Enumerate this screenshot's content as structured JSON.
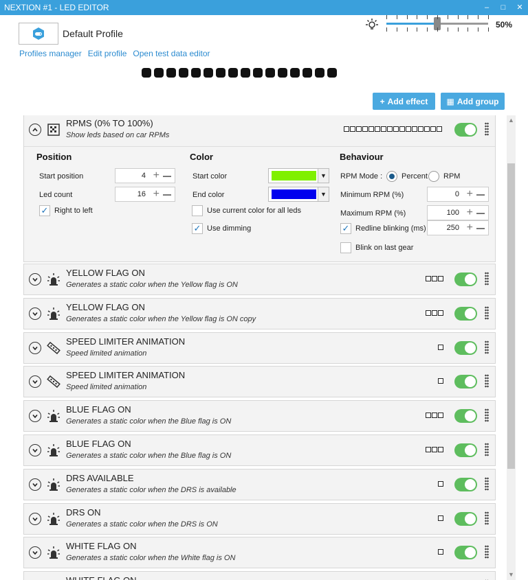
{
  "window": {
    "title": "NEXTION #1 - LED EDITOR",
    "minimize": "–",
    "maximize": "□",
    "close": "✕"
  },
  "profile": {
    "name": "Default Profile"
  },
  "links": {
    "profiles_manager": "Profiles manager",
    "edit_profile": "Edit profile",
    "test_data_editor": "Open test data editor"
  },
  "brightness": {
    "value_label": "50%",
    "value": 0.5
  },
  "led_count": 16,
  "buttons": {
    "add_effect": "Add effect",
    "add_group": "Add group"
  },
  "rpm_effect": {
    "title": "RPMS (0% TO 100%)",
    "subtitle": "Show leds based on car RPMs",
    "led_count": 16,
    "enabled": true,
    "position": {
      "heading": "Position",
      "start_position_label": "Start position",
      "start_position": "4",
      "led_count_label": "Led count",
      "led_count": "16",
      "right_to_left_label": "Right to left",
      "right_to_left": true
    },
    "color": {
      "heading": "Color",
      "start_color_label": "Start color",
      "start_color": "#80f000",
      "end_color_label": "End color",
      "end_color": "#0000ee",
      "use_current_label": "Use current color for all leds",
      "use_current": false,
      "use_dimming_label": "Use dimming",
      "use_dimming": true
    },
    "behaviour": {
      "heading": "Behaviour",
      "rpm_mode_label": "RPM Mode :",
      "mode_percent": "Percent",
      "mode_rpm": "RPM",
      "mode_selected": "Percent",
      "min_rpm_label": "Minimum RPM (%)",
      "min_rpm": "0",
      "max_rpm_label": "Maximum RPM (%)",
      "max_rpm": "100",
      "redline_label": "Redline blinking (ms)",
      "redline": "250",
      "redline_enabled": true,
      "blink_last_gear_label": "Blink on last gear",
      "blink_last_gear": false
    }
  },
  "effects": [
    {
      "title": "YELLOW FLAG ON",
      "subtitle": "Generates a static color when the Yellow flag is ON",
      "icon": "light-icon",
      "leds": 3,
      "enabled": true
    },
    {
      "title": "YELLOW FLAG ON",
      "subtitle": "Generates a static color when the Yellow flag is ON copy",
      "icon": "light-icon",
      "leds": 3,
      "enabled": true
    },
    {
      "title": "SPEED LIMITER ANIMATION",
      "subtitle": "Speed limited animation",
      "icon": "led-strip-icon",
      "leds": 1,
      "enabled": true
    },
    {
      "title": "SPEED LIMITER ANIMATION",
      "subtitle": "Speed limited animation",
      "icon": "led-strip-icon",
      "leds": 1,
      "enabled": true
    },
    {
      "title": "BLUE FLAG ON",
      "subtitle": "Generates a static color when the Blue flag is ON",
      "icon": "light-icon",
      "leds": 3,
      "enabled": true
    },
    {
      "title": "BLUE FLAG ON",
      "subtitle": "Generates a static color when the Blue flag is ON",
      "icon": "light-icon",
      "leds": 3,
      "enabled": true
    },
    {
      "title": "DRS AVAILABLE",
      "subtitle": "Generates a static color when the DRS is available",
      "icon": "light-icon",
      "leds": 1,
      "enabled": true
    },
    {
      "title": "DRS ON",
      "subtitle": "Generates a static color when the DRS is ON",
      "icon": "light-icon",
      "leds": 1,
      "enabled": true
    },
    {
      "title": "WHITE FLAG ON",
      "subtitle": "Generates a static color when the White flag is ON",
      "icon": "light-icon",
      "leds": 1,
      "enabled": true
    },
    {
      "title": "WHITE FLAG ON",
      "subtitle": "",
      "icon": "light-icon",
      "leds": 1,
      "enabled": true
    }
  ],
  "colors": {
    "accent": "#3aa0dc",
    "toggle_on": "#5ebd5e",
    "link": "#2b8bd0"
  }
}
